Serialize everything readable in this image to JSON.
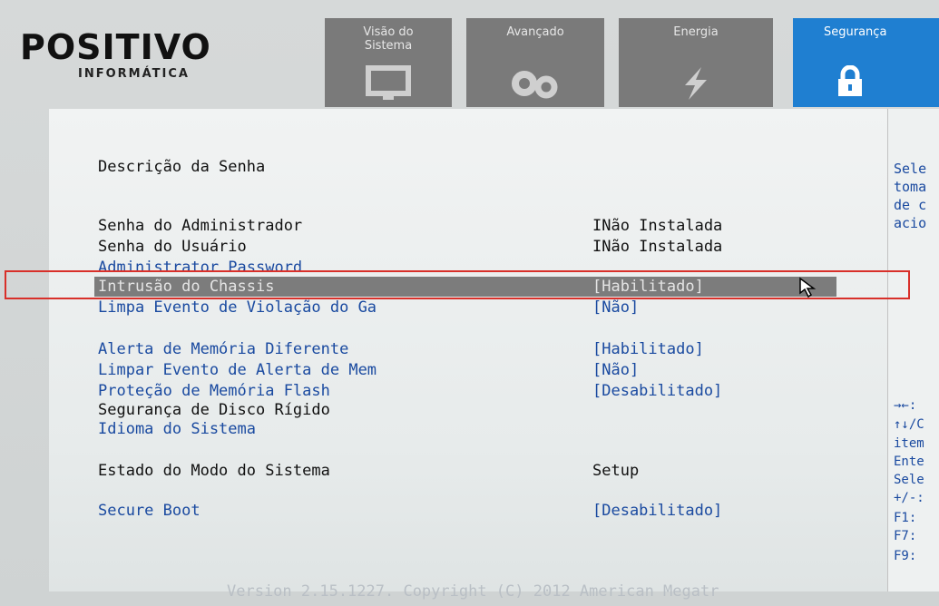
{
  "brand": {
    "name": "POSITIVO",
    "sub": "INFORMÁTICA"
  },
  "tabs": [
    {
      "label": "Visão do\nSistema",
      "icon": "monitor-icon"
    },
    {
      "label": "Avançado",
      "icon": "gears-icon"
    },
    {
      "label": "Energia",
      "icon": "lightning-icon"
    },
    {
      "label": "Segurança",
      "icon": "lock-icon",
      "active": true
    }
  ],
  "main": {
    "section_title": "Descrição da Senha",
    "rows": [
      {
        "label": "Senha do Administrador",
        "value": "INão Instalada"
      },
      {
        "label": "Senha do Usuário",
        "value": "INão Instalada"
      },
      {
        "label": "Administrator Password",
        "value": ""
      },
      {
        "label": "Intrusão do Chassis",
        "value": "[Habilitado]",
        "selected": true
      },
      {
        "label": "Limpa Evento de Violação do Ga",
        "value": "[Não]"
      },
      {
        "label": "Alerta de Memória Diferente",
        "value": "[Habilitado]"
      },
      {
        "label": "Limpar Evento de Alerta de Mem",
        "value": "[Não]"
      },
      {
        "label": "Proteção de Memória Flash",
        "value": "[Desabilitado]"
      },
      {
        "label": "Segurança de Disco Rígido",
        "value": ""
      },
      {
        "label": "Idioma do Sistema",
        "value": ""
      },
      {
        "label": "Estado do Modo do Sistema",
        "value": "Setup"
      },
      {
        "label": "Secure Boot",
        "value": "[Desabilitado]"
      }
    ]
  },
  "help": {
    "lines": [
      "Sele",
      "toma",
      "de c",
      "acio"
    ],
    "keys": [
      "→←:",
      "↑↓/C",
      "item",
      "Ente",
      "Sele",
      "+/-:",
      "F1:",
      "F7:",
      "F9:"
    ]
  },
  "footer": "Version 2.15.1227. Copyright (C) 2012 American Megatr",
  "colors": {
    "accent": "#1f7fd1",
    "tab_inactive": "#7a7a7a",
    "link_blue": "#1a4aa0",
    "highlight": "#d8302a"
  }
}
